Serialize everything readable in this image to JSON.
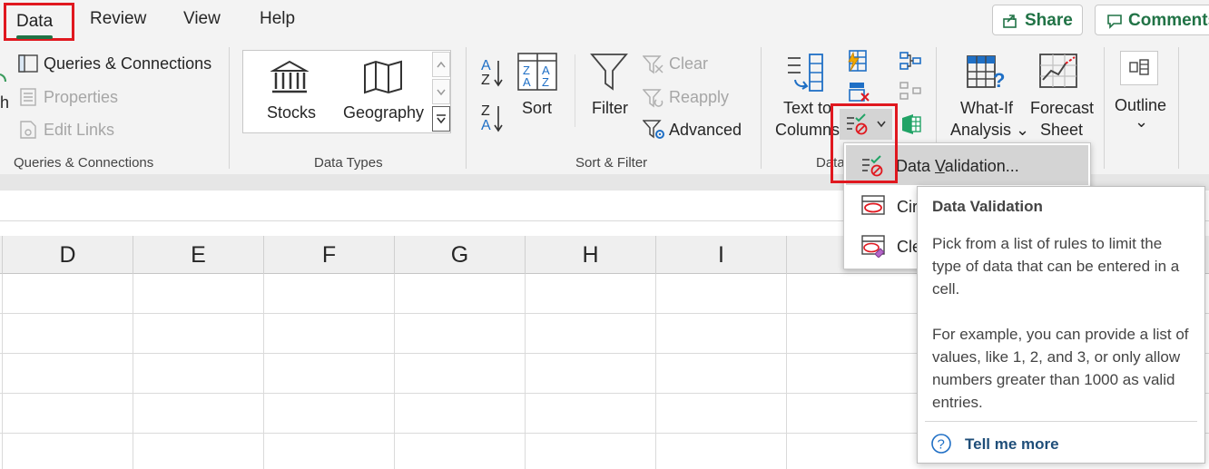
{
  "tabs": {
    "data": "Data",
    "review": "Review",
    "view": "View",
    "help": "Help"
  },
  "actions": {
    "share": "Share",
    "comments": "Comments"
  },
  "queries_group": {
    "refresh_partial": "h",
    "queries_connections": "Queries & Connections",
    "properties": "Properties",
    "edit_links": "Edit Links",
    "label": "Queries & Connections"
  },
  "data_types_group": {
    "stocks": "Stocks",
    "geography": "Geography",
    "label": "Data Types"
  },
  "sort_filter_group": {
    "sort": "Sort",
    "filter": "Filter",
    "clear": "Clear",
    "reapply": "Reapply",
    "advanced": "Advanced",
    "label": "Sort & Filter",
    "sort_asc_top": "A",
    "sort_asc_bottom": "Z",
    "sort_desc_top": "Z",
    "sort_desc_bottom": "A"
  },
  "data_tools_group": {
    "text_to_columns_line1": "Text to",
    "text_to_columns_line2": "Columns",
    "label_partial": "Data"
  },
  "forecast_group": {
    "what_if_line1": "What-If",
    "what_if_line2": "Analysis ⌄",
    "forecast_line1": "Forecast",
    "forecast_line2": "Sheet"
  },
  "outline": {
    "label": "Outline",
    "chevron": "⌄"
  },
  "columns": [
    "D",
    "E",
    "F",
    "G",
    "H",
    "I"
  ],
  "dropdown": {
    "item1_pre": "Data ",
    "item1_mnemonic": "V",
    "item1_post": "alidation...",
    "item2_partial": "Cir",
    "item3_partial": "Cle"
  },
  "tooltip": {
    "title": "Data Validation",
    "para1": "Pick from a list of rules to limit the type of data that can be entered in a cell.",
    "para2": "For example, you can provide a list of values, like 1, 2, and 3, or only allow numbers greater than 1000 as valid entries.",
    "help_link": "Tell me more"
  },
  "colors": {
    "accent_green": "#217346",
    "highlight_red": "#e0181f",
    "link_blue": "#1f4e79"
  }
}
